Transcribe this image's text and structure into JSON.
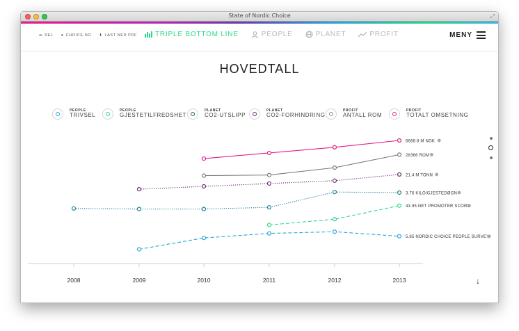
{
  "window": {
    "title": "State of Nordic Choice"
  },
  "nav": {
    "share": "DEL",
    "site": "CHOICE.NO",
    "download": "LAST NED PDF",
    "tabs": [
      {
        "label": "TRIPLE BOTTOM LINE",
        "active": true,
        "icon": "bar-chart-icon"
      },
      {
        "label": "PEOPLE",
        "active": false,
        "icon": "people-icon"
      },
      {
        "label": "PLANET",
        "active": false,
        "icon": "globe-icon"
      },
      {
        "label": "PROFIT",
        "active": false,
        "icon": "trend-icon"
      }
    ],
    "menu": "MENY"
  },
  "page": {
    "title": "HOVEDTALL"
  },
  "legend": [
    {
      "category": "PEOPLE",
      "name": "TRIVSEL",
      "color": "#2aa6d8"
    },
    {
      "category": "PEOPLE",
      "name": "GJESTETILFREDSHET",
      "color": "#2fd68a"
    },
    {
      "category": "PLANET",
      "name": "CO2-UTSLIPP",
      "color": "#1f5f6a"
    },
    {
      "category": "PLANET",
      "name": "CO2-FORHINDRING",
      "color": "#6b2a75"
    },
    {
      "category": "PROFIT",
      "name": "ANTALL ROM",
      "color": "#8a8a8a"
    },
    {
      "category": "PROFIT",
      "name": "TOTALT OMSETNING",
      "color": "#e31c8d"
    }
  ],
  "chart_data": {
    "type": "line",
    "x": [
      "2008",
      "2009",
      "2010",
      "2011",
      "2012",
      "2013"
    ],
    "series": [
      {
        "name": "TOTALT OMSETNING",
        "color": "#e31c8d",
        "dash": "solid",
        "points": [
          null,
          null,
          0.16,
          0.11,
          0.06,
          0.0
        ],
        "end_label": "6668.8 M NOK"
      },
      {
        "name": "ANTALL ROM",
        "color": "#7a7a7a",
        "dash": "solid",
        "points": [
          null,
          null,
          0.31,
          0.305,
          0.24,
          0.125
        ],
        "end_label": "28366 ROM"
      },
      {
        "name": "CO2-FORHINDRING",
        "color": "#6b2a75",
        "dash": "dotted",
        "points": [
          null,
          0.43,
          0.405,
          0.38,
          0.355,
          0.3
        ],
        "end_label": "21.4 M TONN"
      },
      {
        "name": "CO2-UTSLIPP",
        "color": "#1a7d9a",
        "dash": "dotted",
        "points": [
          0.6,
          0.605,
          0.605,
          0.59,
          0.455,
          0.46
        ],
        "end_label": "3.76 KILO/GJESTEDØGN"
      },
      {
        "name": "GJESTETILFREDSHET",
        "color": "#2fd68a",
        "dash": "dashed",
        "points": [
          null,
          null,
          null,
          0.745,
          0.695,
          0.575
        ],
        "end_label": "43.95 NET PROMOTER SCORE"
      },
      {
        "name": "TRIVSEL",
        "color": "#2aa6d8",
        "dash": "dashed",
        "points": [
          null,
          0.96,
          0.86,
          0.82,
          0.805,
          0.845
        ],
        "end_label": "5.85 NORDIC CHOICE PEOPLE SURVEY"
      }
    ],
    "ylim": [
      0,
      1
    ],
    "grid": false
  }
}
